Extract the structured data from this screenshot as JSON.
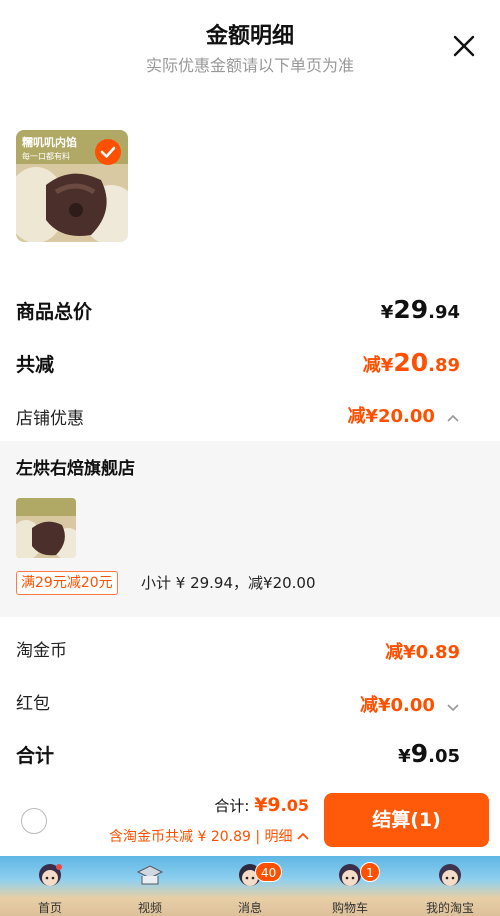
{
  "header": {
    "title": "金额明细",
    "subtitle": "实际优惠金额请以下单页为准"
  },
  "product": {
    "thumb_caption": "糯叽叽内馅",
    "thumb_subcaption": "每一口都有料",
    "selected": true
  },
  "summary": {
    "total_label": "商品总价",
    "total_yen": "¥",
    "total_int": "29",
    "total_dec": ".94",
    "reduce_label": "共减",
    "reduce_prefix": "减¥",
    "reduce_int": "20",
    "reduce_dec": ".89",
    "shop_discount_label": "店铺优惠",
    "shop_discount_value": "减¥20.00"
  },
  "shop": {
    "name": "左烘右焙旗舰店",
    "promo_tag": "满29元减20元",
    "subtotal": "小计 ¥ 29.94，减¥20.00"
  },
  "extras": {
    "coin_label": "淘金币",
    "coin_value": "减¥0.89",
    "redpacket_label": "红包",
    "redpacket_value": "减¥0.00",
    "sum_label": "合计",
    "sum_yen": "¥",
    "sum_int": "9",
    "sum_dec": ".05"
  },
  "bottom": {
    "sum_prefix": "合计: ",
    "sum_value_int": "¥9",
    "sum_value_dec": ".05",
    "detail_text": "含淘金币共减 ¥ 20.89 | 明细",
    "checkout_label": "结算(1)"
  },
  "tabbar": {
    "items": [
      {
        "label": "首页",
        "icon": "home-avatar-icon"
      },
      {
        "label": "视频",
        "icon": "video-icon"
      },
      {
        "label": "消息",
        "icon": "message-avatar-icon",
        "badge": "40"
      },
      {
        "label": "购物车",
        "icon": "cart-avatar-icon",
        "badge": "1"
      },
      {
        "label": "我的淘宝",
        "icon": "profile-avatar-icon"
      }
    ]
  },
  "colors": {
    "accent": "#ff5000",
    "muted_text": "#999999",
    "section_bg": "#f6f6f6"
  }
}
